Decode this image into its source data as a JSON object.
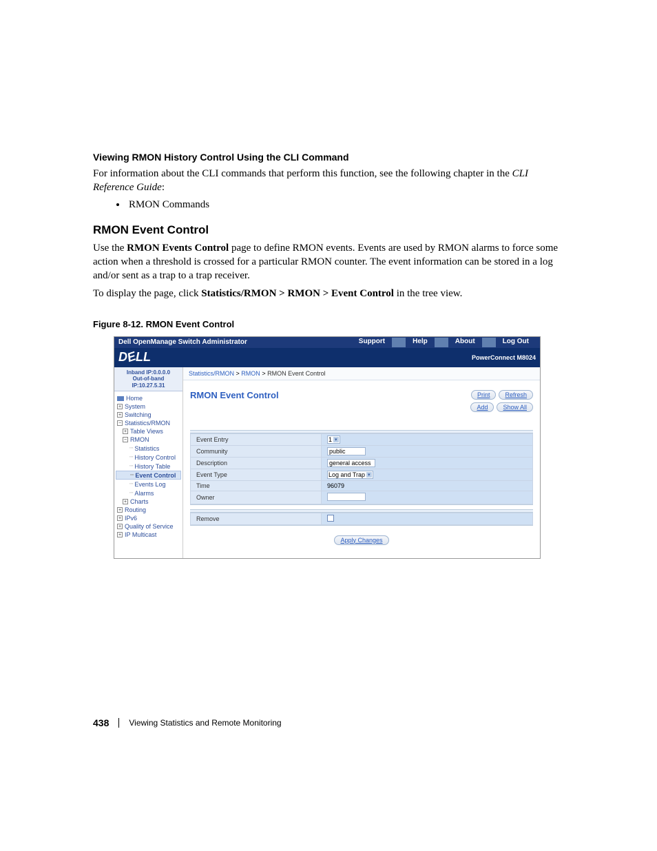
{
  "doc": {
    "cli_heading": "Viewing RMON History Control Using the CLI Command",
    "cli_para_1": "For information about the CLI commands that perform this function, see the following chapter in the ",
    "cli_para_italic": "CLI Reference Guide",
    "cli_para_2": ":",
    "bullet_rmon": "RMON Commands",
    "section_title": "RMON Event Control",
    "para1_a": "Use the ",
    "para1_bold": "RMON Events Control",
    "para1_b": " page to define RMON events. Events are used by RMON alarms to force some action when a threshold is crossed for a particular RMON counter. The event information can be stored in a log and/or sent as a trap to a trap receiver.",
    "para2_a": "To display the page, click ",
    "para2_bold": "Statistics/RMON > RMON > Event Control",
    "para2_b": " in the tree view.",
    "fig_caption": "Figure 8-12.    RMON Event Control",
    "footer_page": "438",
    "footer_text": "Viewing Statistics and Remote Monitoring"
  },
  "shot": {
    "topbar_title": "Dell OpenManage Switch Administrator",
    "topbar_links": [
      "Support",
      "Help",
      "About",
      "Log Out"
    ],
    "logo_text": "DELL",
    "product": "PowerConnect M8024",
    "ip_inband": "Inband IP:0.0.0.0",
    "ip_oob": "Out-of-band IP:10.27.5.31",
    "tree": {
      "home": "Home",
      "system": "System",
      "switching": "Switching",
      "stats": "Statistics/RMON",
      "table_views": "Table Views",
      "rmon": "RMON",
      "statistics": "Statistics",
      "history_control": "History Control",
      "history_table": "History Table",
      "event_control": "Event Control",
      "events_log": "Events Log",
      "alarms": "Alarms",
      "charts": "Charts",
      "routing": "Routing",
      "ipv6": "IPv6",
      "qos": "Quality of Service",
      "ipm": "IP Multicast"
    },
    "crumb_1": "Statistics/RMON",
    "crumb_2": "RMON",
    "crumb_3": "RMON Event Control",
    "main_title": "RMON Event Control",
    "buttons": {
      "print": "Print",
      "refresh": "Refresh",
      "add": "Add",
      "show_all": "Show All",
      "apply": "Apply Changes"
    },
    "form": {
      "event_entry_label": "Event Entry",
      "event_entry_value": "1",
      "community_label": "Community",
      "community_value": "public",
      "description_label": "Description",
      "description_value": "general access",
      "event_type_label": "Event Type",
      "event_type_value": "Log and Trap",
      "time_label": "Time",
      "time_value": "96079",
      "owner_label": "Owner",
      "owner_value": "",
      "remove_label": "Remove"
    }
  }
}
